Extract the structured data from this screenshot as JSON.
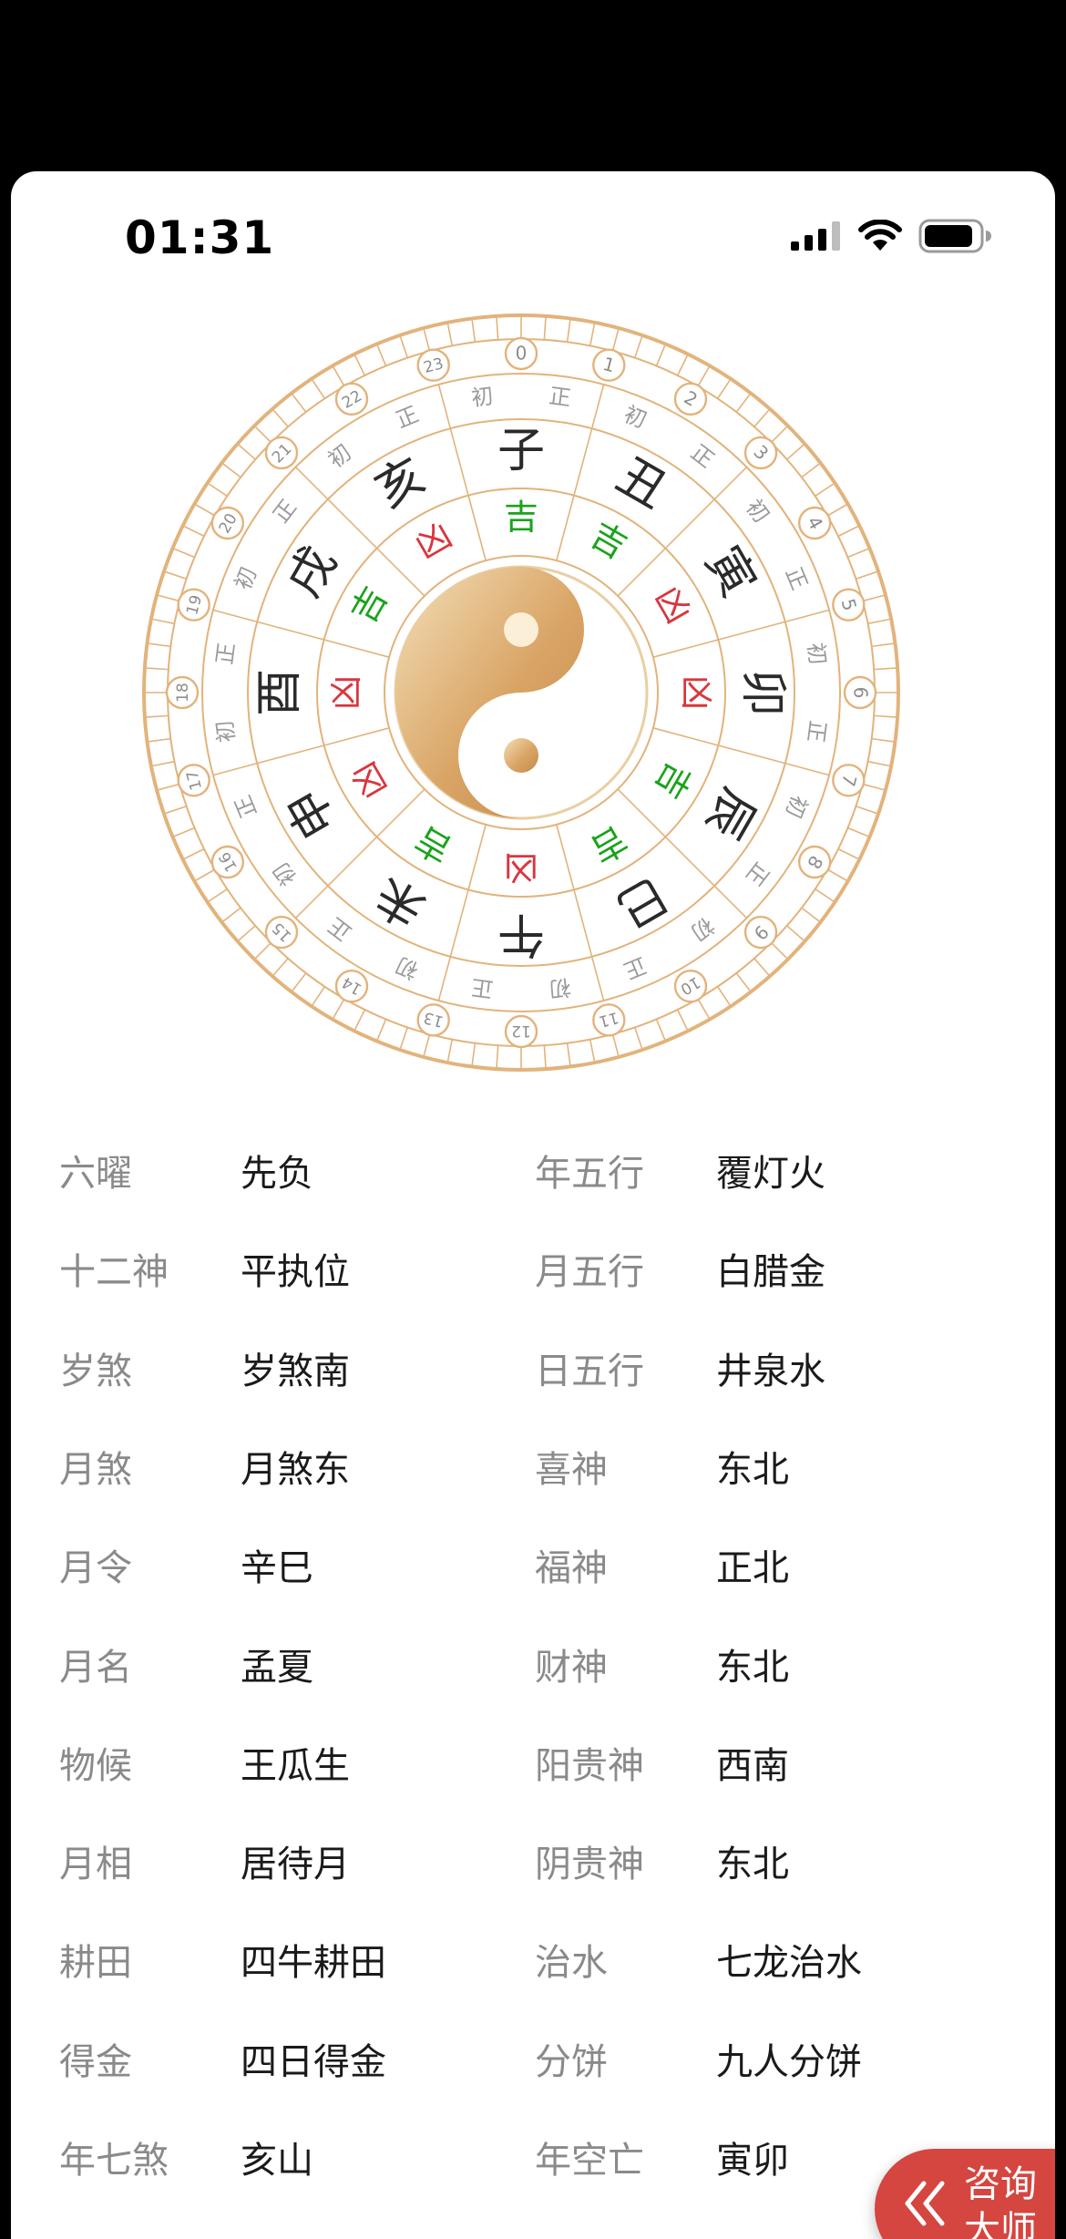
{
  "status": {
    "time": "01:31"
  },
  "wheel": {
    "hours": [
      "0",
      "1",
      "2",
      "3",
      "4",
      "5",
      "6",
      "7",
      "8",
      "9",
      "10",
      "11",
      "12",
      "13",
      "14",
      "15",
      "16",
      "17",
      "18",
      "19",
      "20",
      "21",
      "22",
      "23"
    ],
    "phases": [
      "正",
      "初",
      "正",
      "初",
      "正",
      "初",
      "正",
      "初",
      "正",
      "初",
      "正",
      "初",
      "正",
      "初",
      "正",
      "初",
      "正",
      "初",
      "正",
      "初",
      "正",
      "初",
      "正",
      "初"
    ],
    "branches": [
      "子",
      "丑",
      "寅",
      "卯",
      "辰",
      "巳",
      "午",
      "未",
      "申",
      "酉",
      "戌",
      "亥"
    ],
    "luck": [
      "吉",
      "吉",
      "凶",
      "凶",
      "吉",
      "吉",
      "凶",
      "吉",
      "凶",
      "凶",
      "吉",
      "凶"
    ],
    "colors": {
      "lucky": "#1aa31a",
      "unlucky": "#d9363e",
      "ring": "#e2b37c",
      "gold": "#c9924e"
    }
  },
  "info_rows": [
    {
      "k1": "六曜",
      "v1": "先负",
      "k2": "年五行",
      "v2": "覆灯火"
    },
    {
      "k1": "十二神",
      "v1": "平执位",
      "k2": "月五行",
      "v2": "白腊金"
    },
    {
      "k1": "岁煞",
      "v1": "岁煞南",
      "k2": "日五行",
      "v2": "井泉水"
    },
    {
      "k1": "月煞",
      "v1": "月煞东",
      "k2": "喜神",
      "v2": "东北"
    },
    {
      "k1": "月令",
      "v1": "辛巳",
      "k2": "福神",
      "v2": "正北"
    },
    {
      "k1": "月名",
      "v1": "孟夏",
      "k2": "财神",
      "v2": "东北"
    },
    {
      "k1": "物候",
      "v1": "王瓜生",
      "k2": "阳贵神",
      "v2": "西南"
    },
    {
      "k1": "月相",
      "v1": "居待月",
      "k2": "阴贵神",
      "v2": "东北"
    },
    {
      "k1": "耕田",
      "v1": "四牛耕田",
      "k2": "治水",
      "v2": "七龙治水"
    },
    {
      "k1": "得金",
      "v1": "四日得金",
      "k2": "分饼",
      "v2": "九人分饼"
    },
    {
      "k1": "年七煞",
      "v1": "亥山",
      "k2": "年空亡",
      "v2": "寅卯"
    }
  ],
  "consult": {
    "line1": "咨询",
    "line2": "大师"
  }
}
